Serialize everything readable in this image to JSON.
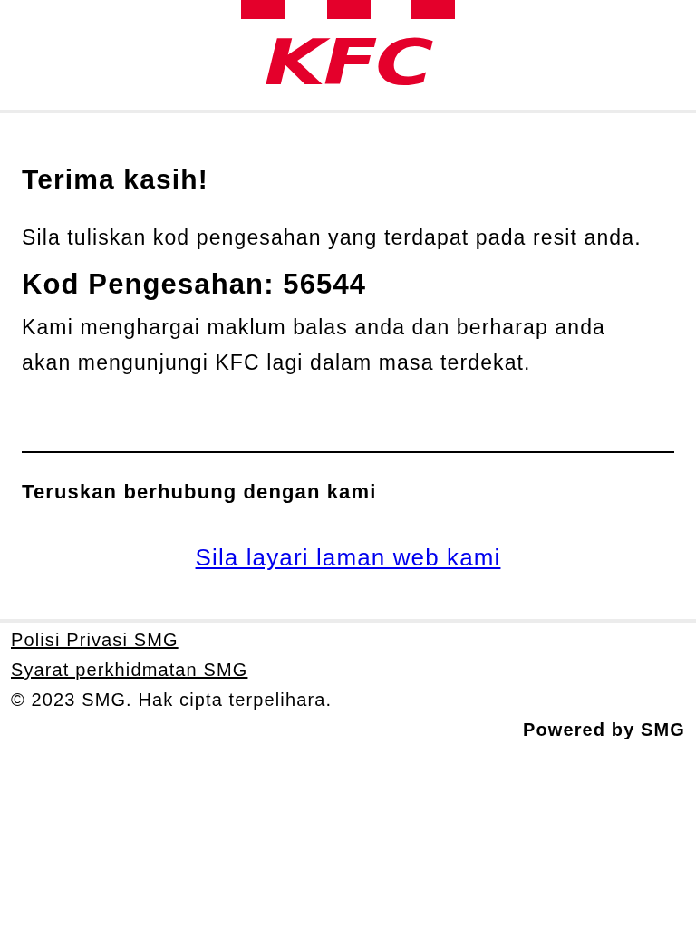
{
  "header": {
    "logo_text": "KFC"
  },
  "thanks": {
    "title": "Terima kasih!",
    "instruction": "Sila tuliskan kod pengesahan yang terdapat pada resit anda.",
    "code": "Kod Pengesahan: 56544",
    "message": "Kami menghargai maklum balas anda dan berharap anda akan mengunjungi KFC lagi dalam masa terdekat."
  },
  "connect": {
    "title": "Teruskan berhubung dengan kami",
    "link": "Sila layari laman web kami"
  },
  "footer": {
    "links": [
      "Polisi Privasi SMG",
      "Syarat perkhidmatan SMG"
    ],
    "copyright": "© 2023 SMG. Hak cipta terpelihara.",
    "powered": "Powered by SMG"
  }
}
